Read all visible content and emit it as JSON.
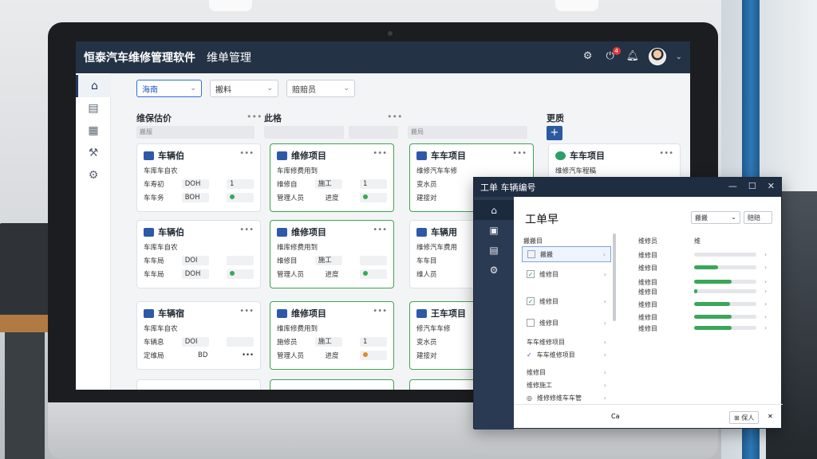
{
  "app": {
    "title": "恒泰汽车维修管理软件",
    "page": "维单管理"
  },
  "topbar": {
    "icons": [
      "settings-icon",
      "notification-icon",
      "alert-icon"
    ],
    "badge": "4"
  },
  "sidebar": {
    "items": [
      "home-icon",
      "orders-icon",
      "grid-icon",
      "tools-icon",
      "gear-icon"
    ]
  },
  "filters": [
    {
      "label": "海南"
    },
    {
      "label": "搬料"
    },
    {
      "label": "赔赔员"
    }
  ],
  "columns": [
    {
      "title": "维保估价",
      "search": "搬服"
    },
    {
      "title": "此格",
      "search": ""
    },
    {
      "title": "",
      "search": "搬局"
    },
    {
      "title": "更质",
      "search": ""
    }
  ],
  "cards": [
    {
      "title": "车辆伯",
      "sub": "车库车自农",
      "r1a": "车寿初",
      "r1b": "DOH",
      "r1c": "1",
      "r2a": "车车务",
      "r2b": "BOH",
      "dot": "#3aa65a",
      "green": false
    },
    {
      "title": "维修项目",
      "sub": "车库修费用到",
      "r1a": "维修自",
      "r1b": "施工",
      "r1c": "1",
      "r2a": "管理人员",
      "r2b": "进度",
      "dot": "#3aa65a",
      "green": true
    },
    {
      "title": "车车项目",
      "sub": "维修汽车车修",
      "r1a": "变水员",
      "r1b": "施工",
      "r1c": "",
      "r2a": "建接对",
      "r2b": "进度",
      "dot": "#3aa65a",
      "green": true
    },
    {
      "title": "车车项目",
      "sub": "维修汽车程稿",
      "r1a": "",
      "r1b": "",
      "r1c": "",
      "r2a": "",
      "r2b": "",
      "dot": "",
      "green": false
    },
    {
      "title": "车辆伯",
      "sub": "车库车自农",
      "r1a": "车车局",
      "r1b": "DOI",
      "r1c": "",
      "r2a": "车车局",
      "r2b": "DOH",
      "dot": "#3aa65a",
      "green": false
    },
    {
      "title": "维修项目",
      "sub": "维库修费用到",
      "r1a": "维修目",
      "r1b": "施工",
      "r1c": "",
      "r2a": "管理人员",
      "r2b": "进度",
      "dot": "#3aa65a",
      "green": true
    },
    {
      "title": "车辆用",
      "sub": "维修汽车费用",
      "r1a": "车车目",
      "r1b": "",
      "r1c": "",
      "r2a": "维人员",
      "r2b": "",
      "dot": "",
      "green": false
    },
    {
      "title": "车辆宿",
      "sub": "车库车自农",
      "r1a": "车辆息",
      "r1b": "DOI",
      "r1c": "",
      "r2a": "定维局",
      "r2b": "BD",
      "dot": "",
      "green": false
    },
    {
      "title": "维修项目",
      "sub": "维库修费用到",
      "r1a": "施修员",
      "r1b": "施工",
      "r1c": "1",
      "r2a": "管理人员",
      "r2b": "进度",
      "dot": "#e08a2a",
      "green": true
    },
    {
      "title": "王车项目",
      "sub": "修汽车车修",
      "r1a": "变水员",
      "r1b": "",
      "r1c": "",
      "r2a": "建接对",
      "r2b": "",
      "dot": "",
      "green": true
    }
  ],
  "dialog": {
    "title": "工单 车辆编号",
    "heading": "工单早",
    "drop1": "搬搬",
    "drop2": "赔赔",
    "list_label": "搬搬目",
    "list": [
      {
        "label": "搬搬",
        "checked": false,
        "selected": true
      },
      {
        "label": "维修目",
        "checked": true,
        "selected": false
      },
      {
        "label": "维修目",
        "checked": true,
        "selected": false
      },
      {
        "label": "维修目",
        "checked": false,
        "selected": false
      }
    ],
    "list_extra": [
      {
        "label": "车车维修项目"
      },
      {
        "label": "车车维修项目"
      },
      {
        "label": "维修目"
      },
      {
        "label": "维修施工"
      },
      {
        "label": "维修修维车车管"
      }
    ],
    "right_header_a": "维修员",
    "right_header_b": "维",
    "progress": [
      {
        "label": "维修目",
        "value": 0.0
      },
      {
        "label": "维修目",
        "value": 0.38
      },
      {
        "label": "维修目",
        "value": 0.6
      },
      {
        "label": "维修目",
        "value": 0.05
      },
      {
        "label": "维修目",
        "value": 0.58
      },
      {
        "label": "维修目",
        "value": 0.6
      },
      {
        "label": "维修目",
        "value": 0.6
      }
    ],
    "footer_left": "Ca",
    "footer_btn": "保人"
  }
}
